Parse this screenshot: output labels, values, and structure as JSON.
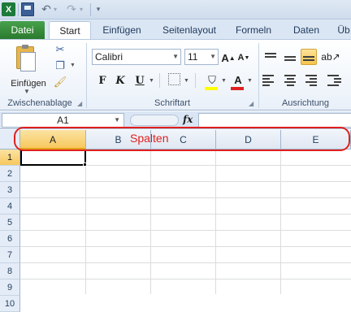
{
  "ribbon_tabs": {
    "file": "Datei",
    "start": "Start",
    "insert": "Einfügen",
    "layout": "Seitenlayout",
    "formulas": "Formeln",
    "data": "Daten",
    "review": "Üb"
  },
  "clipboard": {
    "paste_label": "Einfügen",
    "group_label": "Zwischenablage"
  },
  "font": {
    "name": "Calibri",
    "size": "11",
    "grow_label": "A˄",
    "shrink_label": "A˅",
    "bold_label": "F",
    "italic_label": "K",
    "underline_label": "U",
    "fontcolor_label": "A",
    "group_label": "Schriftart"
  },
  "alignment": {
    "group_label": "Ausrichtung"
  },
  "formula_bar": {
    "name_box": "A1",
    "fx": "fx",
    "value": ""
  },
  "grid": {
    "columns": [
      "A",
      "B",
      "C",
      "D",
      "E"
    ],
    "rows": [
      "1",
      "2",
      "3",
      "4",
      "5",
      "6",
      "7",
      "8",
      "9",
      "10"
    ],
    "active_cell": "A1"
  },
  "annotation": {
    "label": "Spalten",
    "color": "#e0201e"
  },
  "colors": {
    "fill_color": "#ffff00",
    "font_color": "#e02020",
    "selection_accent": "#f7c85e"
  }
}
